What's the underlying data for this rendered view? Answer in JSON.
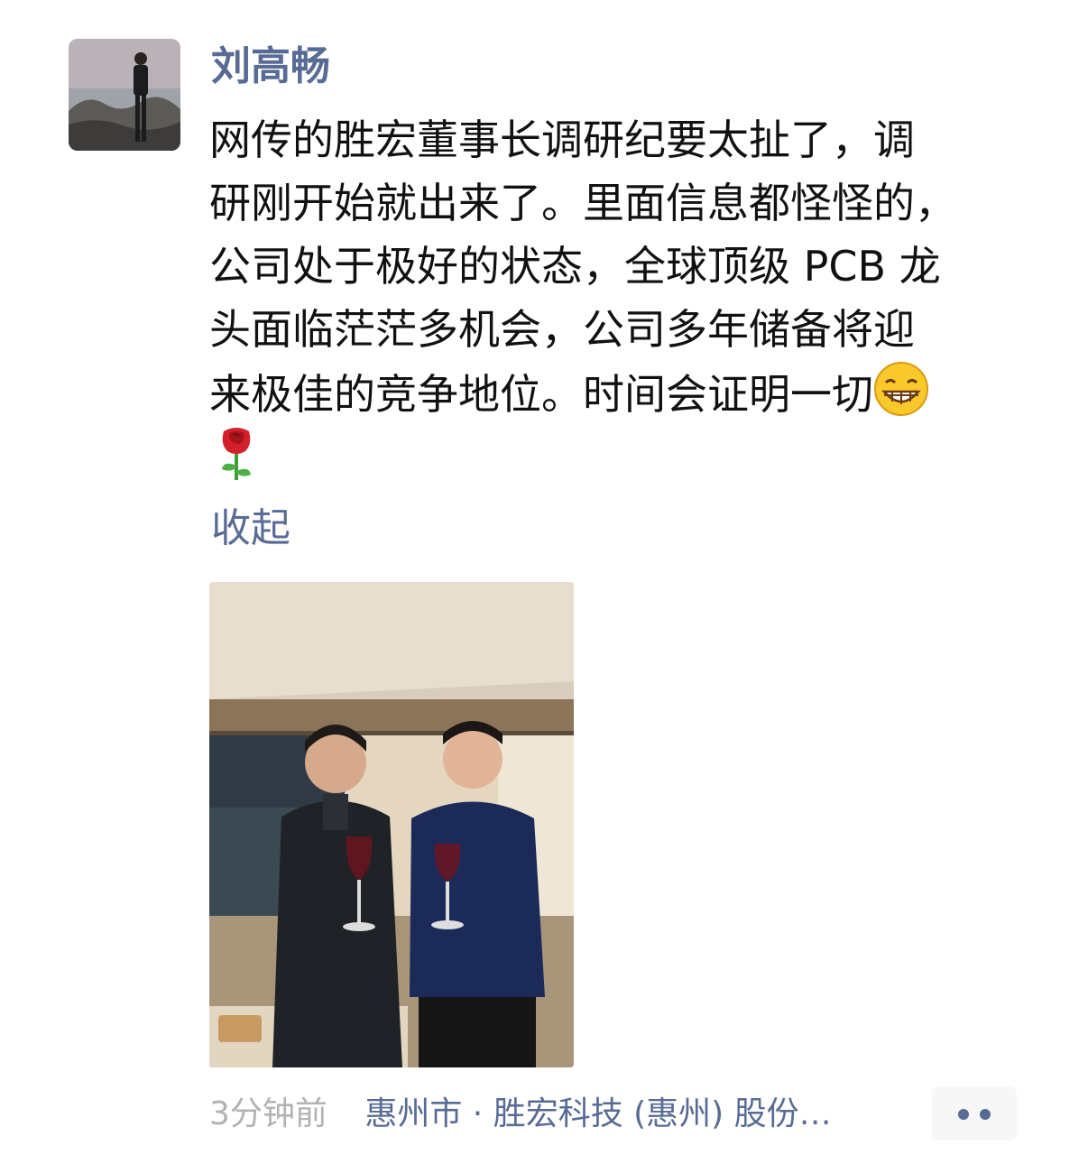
{
  "post": {
    "author_name": "刘高畅",
    "text_lines": [
      "网传的胜宏董事长调研纪要太扯了，调",
      "研刚开始就出来了。里面信息都怪怪的，",
      "公司处于极好的状态，全球顶级 PCB 龙",
      "头面临茫茫多机会，公司多年储备将迎",
      "来极佳的竞争地位。时间会证明一切"
    ],
    "emojis": [
      "grinning-face-emoji",
      "rose-emoji"
    ],
    "collapse_label": "收起",
    "time_ago": "3分钟前",
    "location": "惠州市 · 胜宏科技 (惠州) 股份…",
    "more_icon": "more-dots-icon"
  },
  "colors": {
    "link_blue": "#586b94",
    "text_black": "#111111",
    "time_gray": "#b2b2b2",
    "background": "#ffffff",
    "more_button_bg": "#f7f7f7"
  }
}
